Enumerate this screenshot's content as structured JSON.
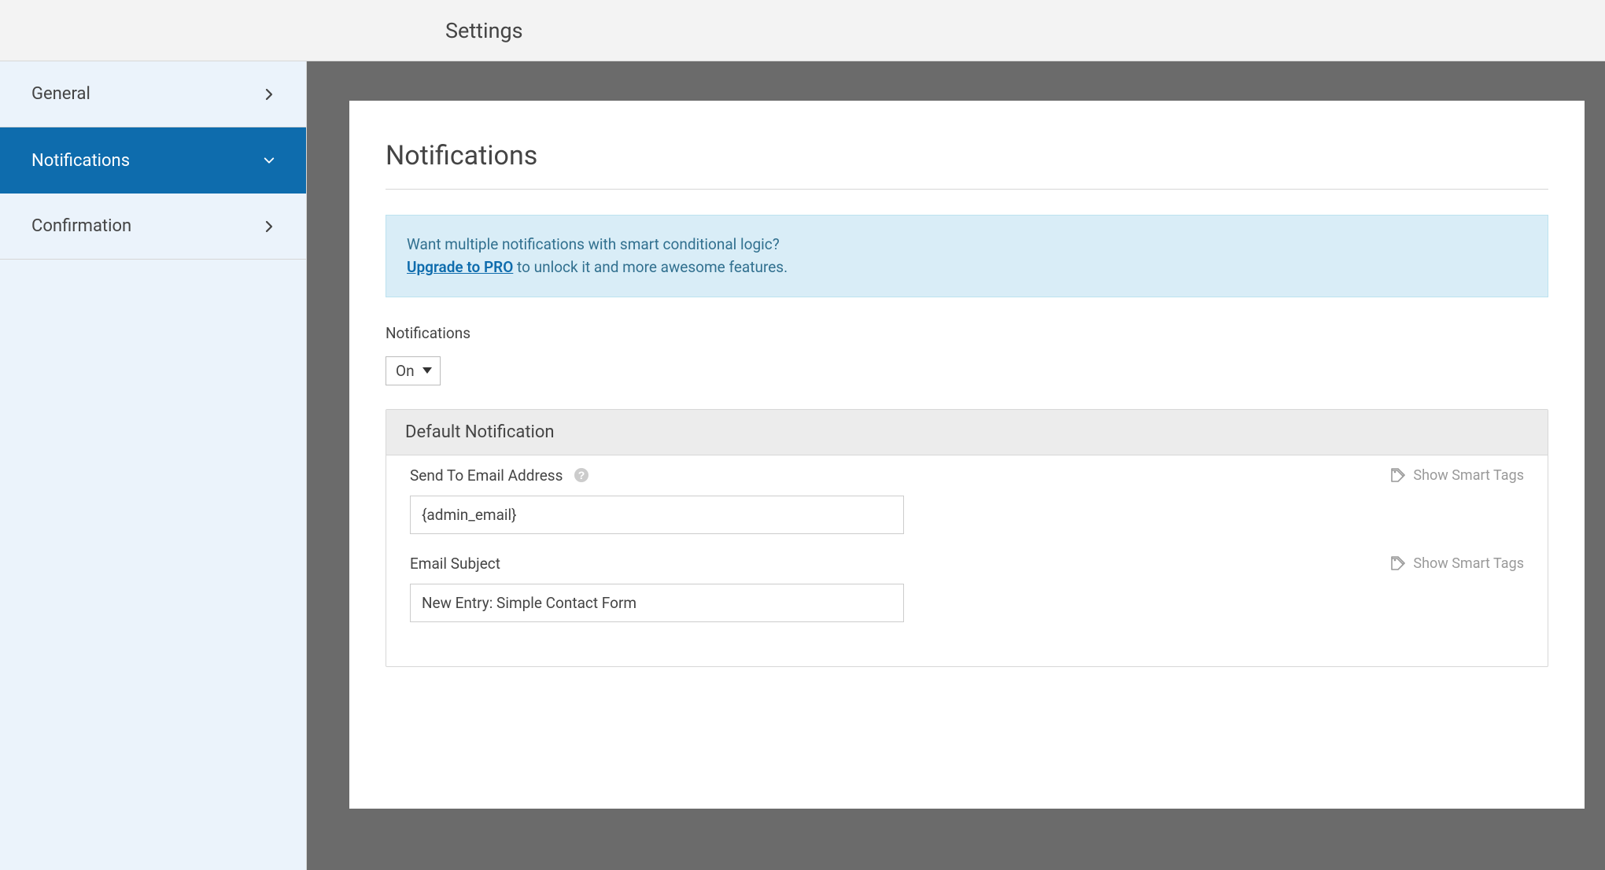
{
  "header": {
    "title": "Settings"
  },
  "sidebar": {
    "items": [
      {
        "label": "General",
        "active": false,
        "arrow": "right"
      },
      {
        "label": "Notifications",
        "active": true,
        "arrow": "down"
      },
      {
        "label": "Confirmation",
        "active": false,
        "arrow": "right"
      }
    ]
  },
  "panel": {
    "title": "Notifications",
    "upsell": {
      "lead": "Want multiple notifications with smart conditional logic?",
      "link_text": "Upgrade to PRO",
      "rest": " to unlock it and more awesome features."
    },
    "toggle": {
      "label": "Notifications",
      "value": "On"
    },
    "notification_box": {
      "header": "Default Notification",
      "fields": [
        {
          "label": "Send To Email Address",
          "has_help": true,
          "smart_tags_label": "Show Smart Tags",
          "value": "{admin_email}"
        },
        {
          "label": "Email Subject",
          "has_help": false,
          "smart_tags_label": "Show Smart Tags",
          "value": "New Entry: Simple Contact Form"
        }
      ]
    }
  }
}
